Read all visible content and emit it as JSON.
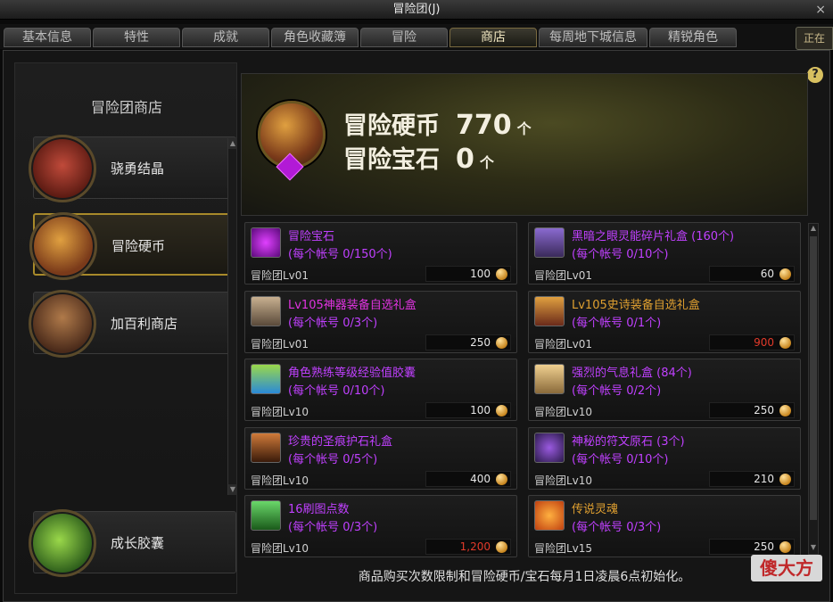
{
  "window": {
    "title": "冒险团(J)",
    "close": "×"
  },
  "tabs": [
    {
      "label": "基本信息"
    },
    {
      "label": "特性"
    },
    {
      "label": "成就"
    },
    {
      "label": "角色收藏簿"
    },
    {
      "label": "冒险"
    },
    {
      "label": "商店",
      "active": true
    },
    {
      "label": "每周地下城信息"
    },
    {
      "label": "精锐角色"
    }
  ],
  "corner_badge": "正在",
  "left_panel": {
    "title": "冒险团商店",
    "categories": [
      {
        "label": "骁勇结晶",
        "icon": "fist-icon"
      },
      {
        "label": "冒险硬币",
        "icon": "treasure-chest-icon",
        "active": true
      },
      {
        "label": "加百利商店",
        "icon": "merchant-icon"
      }
    ],
    "bottom_category": {
      "label": "成长胶囊",
      "icon": "exp-capsule-icon"
    }
  },
  "currency": {
    "coin_label": "冒险硬币",
    "coin_value": "770",
    "coin_unit": "个",
    "gem_label": "冒险宝石",
    "gem_value": "0",
    "gem_unit": "个"
  },
  "help_label": "?",
  "items": [
    {
      "name": "冒险宝石",
      "name_color": "#c040ff",
      "limit": "(每个帐号 0/150个)",
      "level": "冒险团Lv01",
      "price": "100",
      "price_color": "#e6e6e6",
      "icon": "purple-gem-icon"
    },
    {
      "name": "黑暗之眼灵能碎片礼盒 (160个)",
      "name_color": "#c040ff",
      "limit": "(每个帐号 0/10个)",
      "level": "冒险团Lv01",
      "price": "60",
      "price_color": "#e6e6e6",
      "icon": "dark-eye-box-icon"
    },
    {
      "name": "Lv105神器装备自选礼盒",
      "name_color": "#e033e0",
      "limit": "(每个帐号 0/3个)",
      "level": "冒险团Lv01",
      "price": "250",
      "price_color": "#e6e6e6",
      "icon": "artifact-box-icon"
    },
    {
      "name": "Lv105史诗装备自选礼盒",
      "name_color": "#e0a030",
      "limit": "(每个帐号 0/1个)",
      "level": "冒险团Lv01",
      "price": "900",
      "price_color": "#e23a2a",
      "icon": "epic-box-icon"
    },
    {
      "name": "角色熟练等级经验值胶囊",
      "name_color": "#c040ff",
      "limit": "(每个帐号 0/10个)",
      "level": "冒险团Lv10",
      "price": "100",
      "price_color": "#e6e6e6",
      "icon": "exp-capsule-icon"
    },
    {
      "name": "强烈的气息礼盒 (84个)",
      "name_color": "#c040ff",
      "limit": "(每个帐号 0/2个)",
      "level": "冒险团Lv10",
      "price": "250",
      "price_color": "#e6e6e6",
      "icon": "aura-box-icon"
    },
    {
      "name": "珍贵的圣痕护石礼盒",
      "name_color": "#c040ff",
      "limit": "(每个帐号 0/5个)",
      "level": "冒险团Lv10",
      "price": "400",
      "price_color": "#e6e6e6",
      "icon": "stigma-box-icon"
    },
    {
      "name": "神秘的符文原石 (3个)",
      "name_color": "#c040ff",
      "limit": "(每个帐号 0/10个)",
      "level": "冒险团Lv10",
      "price": "210",
      "price_color": "#e6e6e6",
      "icon": "rune-stone-icon"
    },
    {
      "name": "16刷图点数",
      "name_color": "#c040ff",
      "limit": "(每个帐号 0/3个)",
      "level": "冒险团Lv10",
      "price": "1,200",
      "price_color": "#e23a2a",
      "icon": "potion-bottle-icon"
    },
    {
      "name": "传说灵魂",
      "name_color": "#e0a030",
      "limit": "(每个帐号 0/3个)",
      "level": "冒险团Lv15",
      "price": "250",
      "price_color": "#e6e6e6",
      "icon": "legendary-soul-icon"
    }
  ],
  "footer_note": "商品购买次数限制和冒险硬币/宝石每月1日凌晨6点初始化。",
  "watermark": "傻大方",
  "colors": {
    "gold_border": "#a88a2a",
    "purple": "#c040ff",
    "orange": "#e0a030",
    "red_price": "#e23a2a"
  }
}
